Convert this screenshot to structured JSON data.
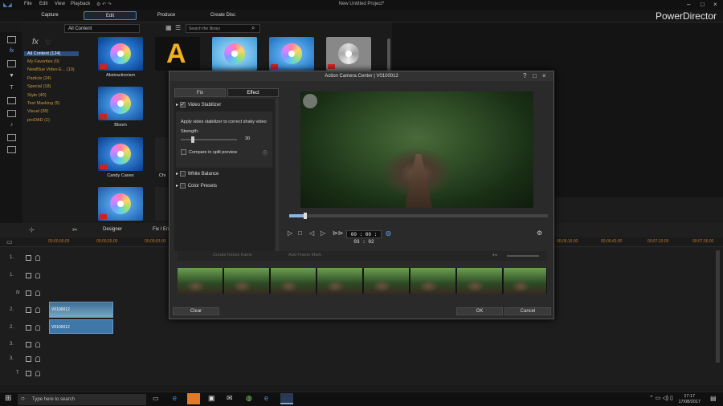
{
  "menu": [
    "File",
    "Edit",
    "View",
    "Playback"
  ],
  "window_title": "New Untitled Project*",
  "brand": "PowerDirector",
  "modes": [
    "Capture",
    "Edit",
    "Produce",
    "Create Disc"
  ],
  "library": {
    "filter": "All Content",
    "search_placeholder": "Search the library",
    "categories": [
      "All Content (124)",
      "My Favorites (0)",
      "NewBlue Video E... (10)",
      "Particle (24)",
      "Special (18)",
      "Style (40)",
      "Text Masking (5)",
      "Visual (28)",
      "proDAD (1)"
    ],
    "thumb_labels": [
      "Abstractionism",
      "Bloom",
      "Candy Canes",
      "Chi"
    ]
  },
  "timeline": {
    "toolbar": [
      "Designer",
      "Fix / En"
    ],
    "ticks": [
      "00;00;00;00",
      "00;00;26;00",
      "00;00;53;00",
      "00;06;16;00",
      "00;06;43;00",
      "00;07;10;00",
      "00;07;36;00",
      "00;08;03;00",
      "00;08;30;00"
    ],
    "tracks": [
      "1.",
      "1.",
      "fx",
      "2.",
      "2.",
      "3.",
      "3.",
      "T"
    ],
    "clip_name": "V0100012"
  },
  "dialog": {
    "title": "Action Camera Center | V0100012",
    "tabs": [
      "Fix",
      "Effect"
    ],
    "stabilizer": {
      "label": "Video Stabilizer",
      "description": "Apply video stabilizer to correct shaky video",
      "strength_label": "Strength:",
      "strength_value": "30",
      "compare_label": "Compare in split preview"
    },
    "white_balance": "White Balance",
    "color_presets": "Color Presets",
    "timecode": "00 : 00 : 03 : 02",
    "freeze_label": "Create freeze frame",
    "keyframe_label": "Add Frame Mark",
    "clear": "Clear",
    "ok": "OK",
    "cancel": "Cancel"
  },
  "taskbar": {
    "search": "Type here to search",
    "time": "17:17",
    "date": "17/08/2017"
  }
}
